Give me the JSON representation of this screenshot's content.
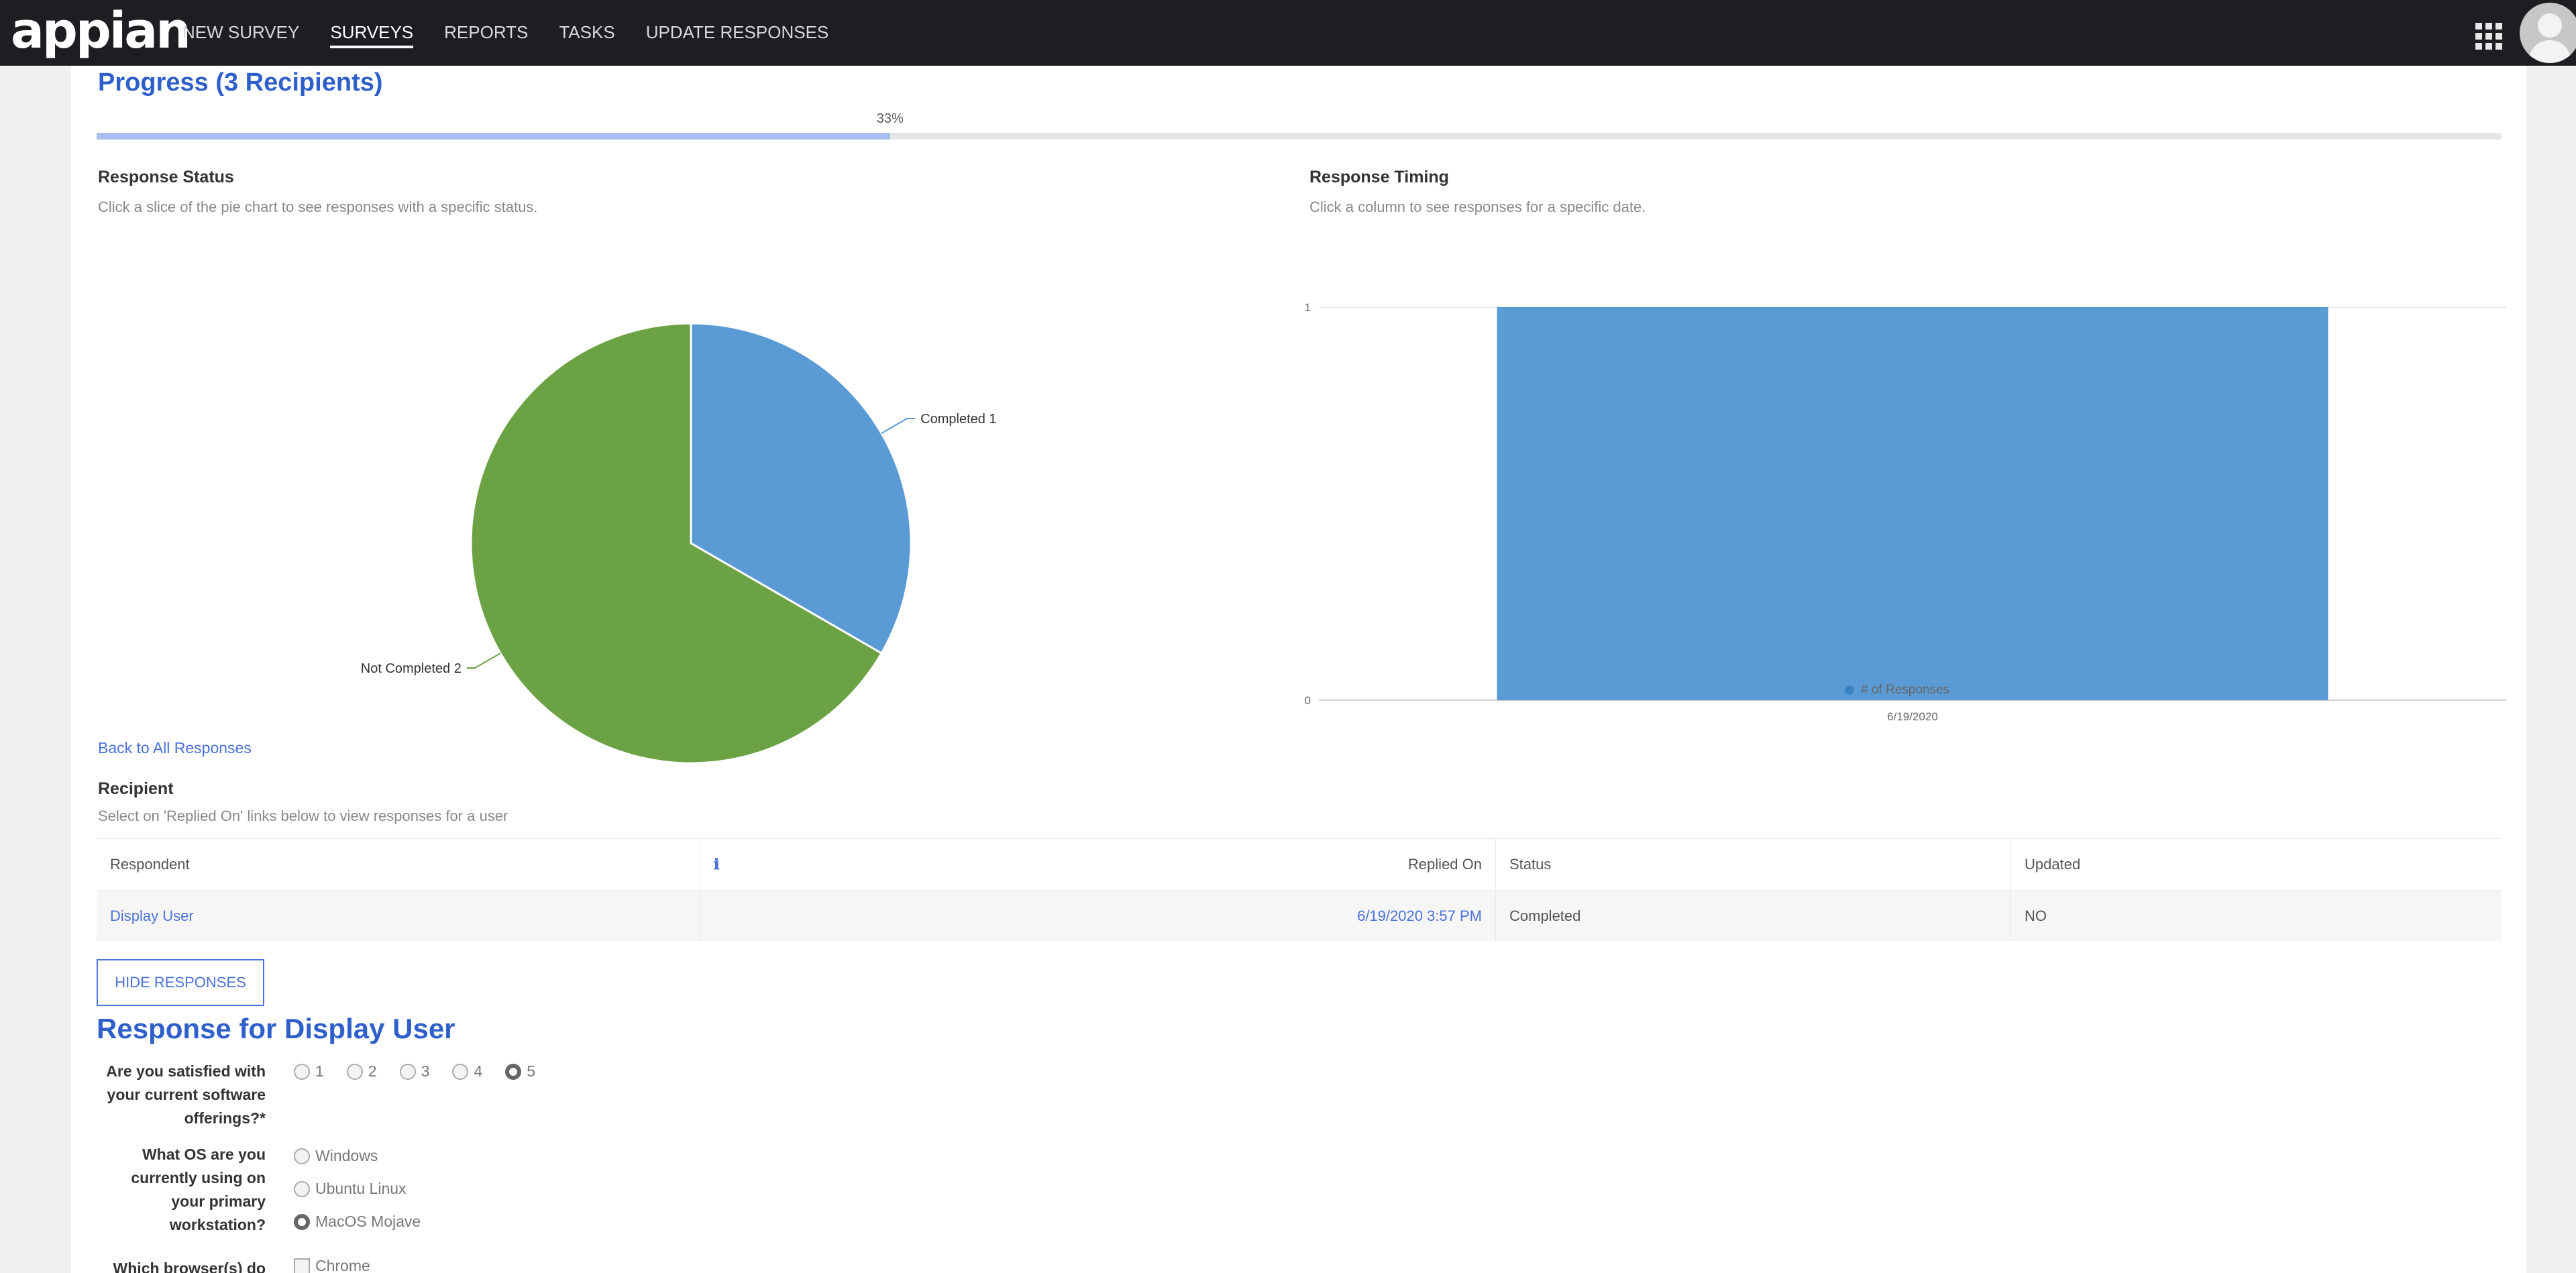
{
  "app": {
    "logo_text": "appian",
    "nav": [
      {
        "label": "NEW SURVEY",
        "active": false
      },
      {
        "label": "SURVEYS",
        "active": true
      },
      {
        "label": "REPORTS",
        "active": false
      },
      {
        "label": "TASKS",
        "active": false
      },
      {
        "label": "UPDATE RESPONSES",
        "active": false
      }
    ]
  },
  "progress": {
    "title": "Progress (3 Recipients)",
    "percent_label": "33%",
    "fraction": 0.33
  },
  "response_status": {
    "title": "Response Status",
    "subtitle": "Click a slice of the pie chart to see responses with a specific status."
  },
  "response_timing": {
    "title": "Response Timing",
    "subtitle": "Click a column to see responses for a specific date."
  },
  "chart_data": [
    {
      "type": "pie",
      "slices": [
        {
          "label": "Completed",
          "value": 1,
          "color": "#5b9bd5"
        },
        {
          "label": "Not Completed",
          "value": 2,
          "color": "#6aa244"
        }
      ]
    },
    {
      "type": "bar",
      "categories": [
        "6/19/2020"
      ],
      "series": [
        {
          "name": "# of Responses",
          "values": [
            1
          ],
          "color": "#5b9bd5"
        }
      ],
      "y_ticks": [
        "0",
        "1"
      ],
      "ylim": [
        0,
        1
      ],
      "legend": "bottom"
    }
  ],
  "back_link": "Back to All Responses",
  "recipient": {
    "title": "Recipient",
    "subtitle": "Select on 'Replied On' links below to view responses for a user",
    "columns": [
      "Respondent",
      "",
      "Replied On",
      "Status",
      "Updated"
    ],
    "rows": [
      {
        "respondent": "Display User",
        "info": "",
        "replied_on": "6/19/2020 3:57 PM",
        "status": "Completed",
        "updated": "NO"
      }
    ]
  },
  "hide_button": "HIDE RESPONSES",
  "response_section": {
    "title": "Response for Display User",
    "q1": {
      "label": "Are you satisfied with your current software offerings?*",
      "options": [
        "1",
        "2",
        "3",
        "4",
        "5"
      ],
      "selected": "5"
    },
    "q2": {
      "label": "What OS are you currently using on your primary workstation?",
      "options": [
        "Windows",
        "Ubuntu Linux",
        "MacOS Mojave"
      ],
      "selected": "MacOS Mojave"
    },
    "q3": {
      "label": "Which browser(s) do",
      "options": [
        "Chrome"
      ]
    }
  }
}
